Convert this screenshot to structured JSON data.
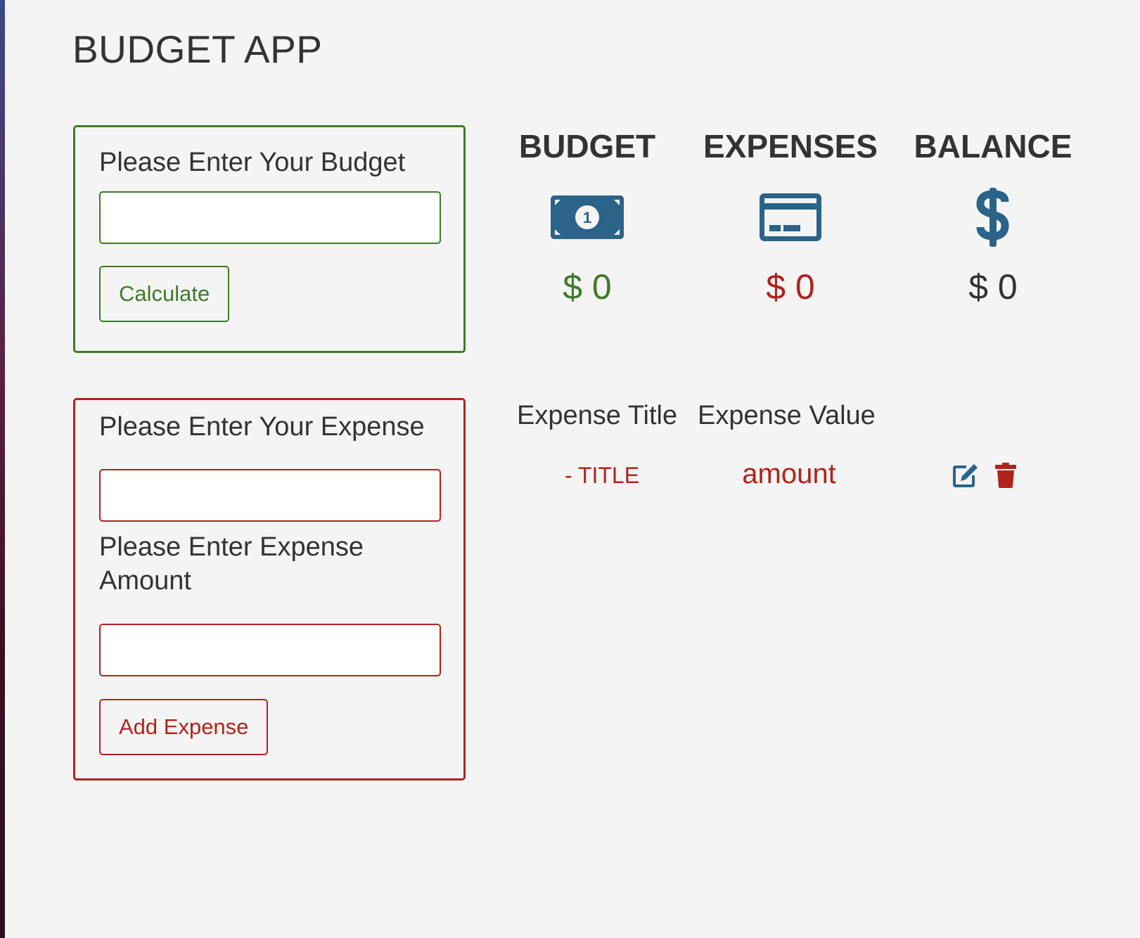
{
  "app": {
    "title": "BUDGET APP"
  },
  "budget_form": {
    "label": "Please Enter Your Budget",
    "input_value": "",
    "button_label": "Calculate"
  },
  "expense_form": {
    "title_label": "Please Enter Your Expense",
    "title_input_value": "",
    "amount_label": "Please Enter Expense Amount",
    "amount_input_value": "",
    "button_label": "Add Expense"
  },
  "stats": {
    "budget": {
      "label": "BUDGET",
      "value": "$ 0",
      "icon": "money-bill-icon"
    },
    "expenses": {
      "label": "EXPENSES",
      "value": "$ 0",
      "icon": "credit-card-icon"
    },
    "balance": {
      "label": "BALANCE",
      "value": "$ 0",
      "icon": "dollar-sign-icon"
    }
  },
  "expense_list": {
    "headers": [
      "Expense Title",
      "Expense Value"
    ],
    "rows": [
      {
        "title": "- TITLE",
        "value": "amount",
        "actions": [
          "edit-icon",
          "trash-icon"
        ]
      }
    ]
  },
  "colors": {
    "background": "#f4f4f4",
    "budget_accent": "#3e7b27",
    "expense_accent": "#b0231d",
    "icon_blue": "#2b6389",
    "text": "#333333"
  }
}
